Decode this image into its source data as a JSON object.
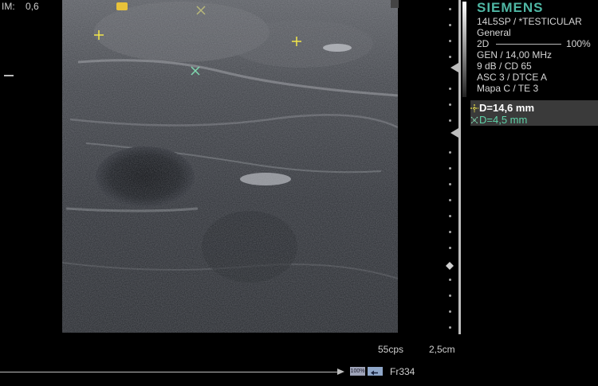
{
  "header": {
    "im_label": "IM:",
    "im_value": "0,6"
  },
  "panel": {
    "brand": "SIEMENS",
    "probe": "14L5SP / *TESTICULAR",
    "preset": "General",
    "mode": "2D",
    "power": "100%",
    "gen": "GEN / 14,00 MHz",
    "gain": "9 dB / CD 65",
    "asc": "ASC 3 / DTCE A",
    "map": "Mapa C / TE 3"
  },
  "measurements": {
    "d1": "D=14,6 mm",
    "d2": "D=4,5 mm",
    "d1_color": "#ffffff",
    "d2_color": "#5fd3a8",
    "d1_marker_color": "#f2e64a",
    "d2_marker_color": "#7fd9b0"
  },
  "footer": {
    "frame_rate": "55cps",
    "depth": "2,5cm",
    "zoom_badge": "100%",
    "frame": "Fr334"
  }
}
